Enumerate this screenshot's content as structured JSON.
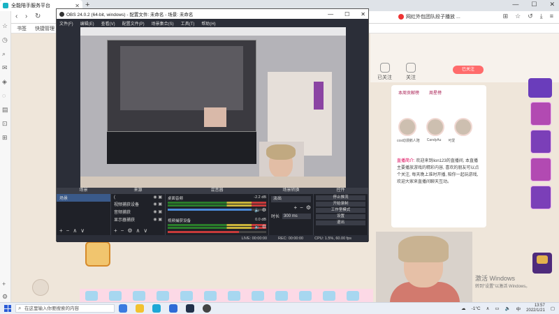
{
  "browser": {
    "tab_title": "全能陪手服务平台",
    "bookmarks": [
      "书签",
      "快捷管理"
    ],
    "notice": "网红外包团队段子播放 ..."
  },
  "obs": {
    "title": "OBS 24.0.2 (64-bit, windows) - 配置文件: 未命名 - 场景: 未命名",
    "menu": [
      "文件(F)",
      "编辑(E)",
      "查看(V)",
      "配置文件(P)",
      "场景集合(S)",
      "工具(T)",
      "帮助(H)"
    ],
    "docks": {
      "scenes": {
        "title": "场景",
        "items": [
          "场景"
        ]
      },
      "sources": {
        "title": "来源",
        "items": [
          "(",
          "视频捕获设备",
          "音频捕获",
          "显示器捕获"
        ]
      },
      "mixer": {
        "title": "混音器",
        "channels": [
          {
            "name": "桌面音频",
            "db": "-2.2 dB",
            "level": 0.85
          },
          {
            "name": "视频捕获设备",
            "db": "0.0 dB",
            "level": 0.72
          }
        ]
      },
      "transitions": {
        "title": "场景转换",
        "selected": "淡出",
        "duration_label": "时长",
        "duration": "300 ms"
      },
      "controls": {
        "title": "控件",
        "buttons": [
          "停止推流",
          "开始录制",
          "工作室模式",
          "设置",
          "退出"
        ]
      }
    },
    "status": {
      "live": "LIVE: 00:00:00",
      "rec": "REC: 00:00:00",
      "cpu": "CPU: 1.5%, 60.00 fps"
    }
  },
  "page": {
    "top_icons": [
      "已关注",
      "关注",
      "分享"
    ],
    "follow": "已关注",
    "rank_tabs": [
      "本周贡献榜",
      "周星榜"
    ],
    "rank_names": [
      "cos动漫鹅人陪",
      "CandyAu",
      "可爱"
    ],
    "intro_title": "直播简介:",
    "intro_text": "欢迎来到lion123的直播间, 本直播主要播放游戏的精彩内容, 喜欢的朋友可以点个关注, 每天晚上准时开播, 陪你一起玩游戏, 欢迎大家来直播间聊天互动。"
  },
  "activate": {
    "title": "激活 Windows",
    "sub": "转到\"设置\"以激活 Windows。"
  },
  "taskbar": {
    "search_placeholder": "在这里输入你要搜索的内容",
    "temp": "-1°C",
    "lang": "中",
    "time": "13:57",
    "date": "2022/1/21"
  },
  "colors": {
    "obs_bg": "#2b2e38",
    "follow_btn": "#ff6b6b",
    "accent_purple": "#8b44a3"
  }
}
